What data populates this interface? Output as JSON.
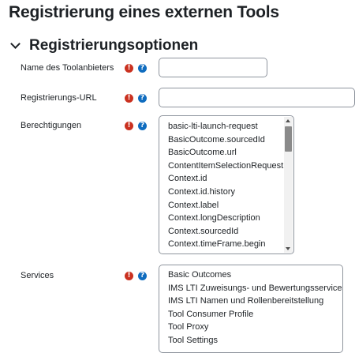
{
  "page": {
    "title": "Registrierung eines externen Tools",
    "section_title": "Registrierungsoptionen"
  },
  "fields": {
    "tool_provider_name": {
      "label": "Name des Toolanbieters",
      "value": ""
    },
    "registration_url": {
      "label": "Registrierungs-URL",
      "value": ""
    },
    "capabilities": {
      "label": "Berechtigungen",
      "options": [
        "basic-lti-launch-request",
        "BasicOutcome.sourcedId",
        "BasicOutcome.url",
        "ContentItemSelectionRequest",
        "Context.id",
        "Context.id.history",
        "Context.label",
        "Context.longDescription",
        "Context.sourcedId",
        "Context.timeFrame.begin"
      ]
    },
    "services": {
      "label": "Services",
      "options": [
        "Basic Outcomes",
        "IMS LTI Zuweisungs- und Bewertungsservices",
        "IMS LTI Namen und Rollenbereitstellung",
        "Tool Consumer Profile",
        "Tool Proxy",
        "Tool Settings"
      ]
    }
  },
  "icons": {
    "required": {
      "name": "exclamation-icon",
      "glyph": "!",
      "color": "#ca3120"
    },
    "help": {
      "name": "help-icon",
      "glyph": "?",
      "color": "#0f6cbf"
    }
  }
}
